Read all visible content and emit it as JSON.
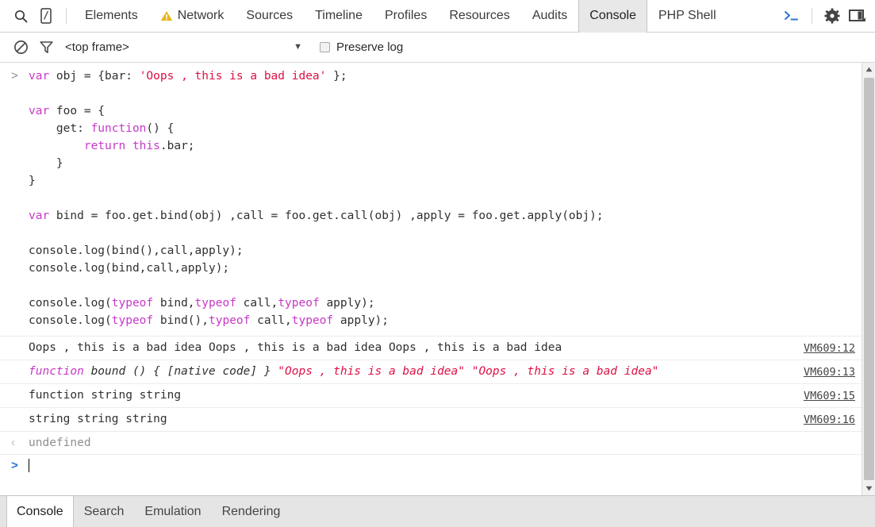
{
  "toolbar": {
    "left_icons": [
      {
        "name": "search-icon",
        "label": "Search"
      },
      {
        "name": "device-mode-icon",
        "label": "Toggle device mode"
      }
    ],
    "tabs": [
      {
        "label": "Elements",
        "active": false,
        "warning": false
      },
      {
        "label": "Network",
        "active": false,
        "warning": true
      },
      {
        "label": "Sources",
        "active": false,
        "warning": false
      },
      {
        "label": "Timeline",
        "active": false,
        "warning": false
      },
      {
        "label": "Profiles",
        "active": false,
        "warning": false
      },
      {
        "label": "Resources",
        "active": false,
        "warning": false
      },
      {
        "label": "Audits",
        "active": false,
        "warning": false
      },
      {
        "label": "Console",
        "active": true,
        "warning": false
      },
      {
        "label": "PHP Shell",
        "active": false,
        "warning": false
      }
    ],
    "right_icons": [
      {
        "name": "console-drawer-icon",
        "label": "Show console drawer"
      },
      {
        "name": "gear-icon",
        "label": "Settings"
      },
      {
        "name": "dock-panel-icon",
        "label": "Dock side"
      }
    ]
  },
  "filterbar": {
    "clear_label": "Clear console",
    "filter_label": "Filter",
    "context": "<top frame>",
    "context_arrow": "▼",
    "preserve_log_label": "Preserve log",
    "preserve_log_checked": false
  },
  "console": {
    "prompt_chevron": ">",
    "result_chevron": "‹",
    "input_lines": [
      [
        {
          "t": "var ",
          "c": "kw"
        },
        {
          "t": "obj = {bar: ",
          "c": ""
        },
        {
          "t": "'Oops , this is a bad idea'",
          "c": "str"
        },
        {
          "t": " };",
          "c": ""
        }
      ],
      [],
      [
        {
          "t": "var ",
          "c": "kw"
        },
        {
          "t": "foo = {",
          "c": ""
        }
      ],
      [
        {
          "t": "    get: ",
          "c": ""
        },
        {
          "t": "function",
          "c": "kw"
        },
        {
          "t": "() {",
          "c": ""
        }
      ],
      [
        {
          "t": "        ",
          "c": ""
        },
        {
          "t": "return ",
          "c": "kw"
        },
        {
          "t": "this",
          "c": "kw"
        },
        {
          "t": ".bar;",
          "c": ""
        }
      ],
      [
        {
          "t": "    }",
          "c": ""
        }
      ],
      [
        {
          "t": "}",
          "c": ""
        }
      ],
      [],
      [
        {
          "t": "var ",
          "c": "kw"
        },
        {
          "t": "bind = foo.get.bind(obj) ,call = foo.get.call(obj) ,apply = foo.get.apply(obj);",
          "c": ""
        }
      ],
      [],
      [
        {
          "t": "console.log(bind(),call,apply);",
          "c": ""
        }
      ],
      [
        {
          "t": "console.log(bind,call,apply);",
          "c": ""
        }
      ],
      [],
      [
        {
          "t": "console.log(",
          "c": ""
        },
        {
          "t": "typeof",
          "c": "kw"
        },
        {
          "t": " bind,",
          "c": ""
        },
        {
          "t": "typeof",
          "c": "kw"
        },
        {
          "t": " call,",
          "c": ""
        },
        {
          "t": "typeof",
          "c": "kw"
        },
        {
          "t": " apply);",
          "c": ""
        }
      ],
      [
        {
          "t": "console.log(",
          "c": ""
        },
        {
          "t": "typeof",
          "c": "kw"
        },
        {
          "t": " bind(),",
          "c": ""
        },
        {
          "t": "typeof",
          "c": "kw"
        },
        {
          "t": " call,",
          "c": ""
        },
        {
          "t": "typeof",
          "c": "kw"
        },
        {
          "t": " apply);",
          "c": ""
        }
      ]
    ],
    "output_rows": [
      {
        "italic": false,
        "parts": [
          {
            "t": "Oops , this is a bad idea Oops , this is a bad idea Oops , this is a bad idea",
            "c": ""
          }
        ],
        "source": "VM609:12"
      },
      {
        "italic": true,
        "parts": [
          {
            "t": "function ",
            "c": "kw"
          },
          {
            "t": "bound () { [native code] } ",
            "c": ""
          },
          {
            "t": "\"Oops , this is a bad idea\" \"Oops , this is a bad idea\"",
            "c": "str"
          }
        ],
        "source": "VM609:13"
      },
      {
        "italic": false,
        "parts": [
          {
            "t": "function string string",
            "c": ""
          }
        ],
        "source": "VM609:15"
      },
      {
        "italic": false,
        "parts": [
          {
            "t": "string string string",
            "c": ""
          }
        ],
        "source": "VM609:16"
      }
    ],
    "result_value": "undefined",
    "input_value": ""
  },
  "drawer": {
    "tabs": [
      {
        "label": "Console",
        "active": true
      },
      {
        "label": "Search",
        "active": false
      },
      {
        "label": "Emulation",
        "active": false
      },
      {
        "label": "Rendering",
        "active": false
      }
    ]
  },
  "colors": {
    "keyword": "#c838c8",
    "string": "#d14",
    "link": "#444444",
    "prompt": "#2b74d6",
    "warning": "#e8b51f",
    "active_tab_bg": "#e8e8e8"
  }
}
